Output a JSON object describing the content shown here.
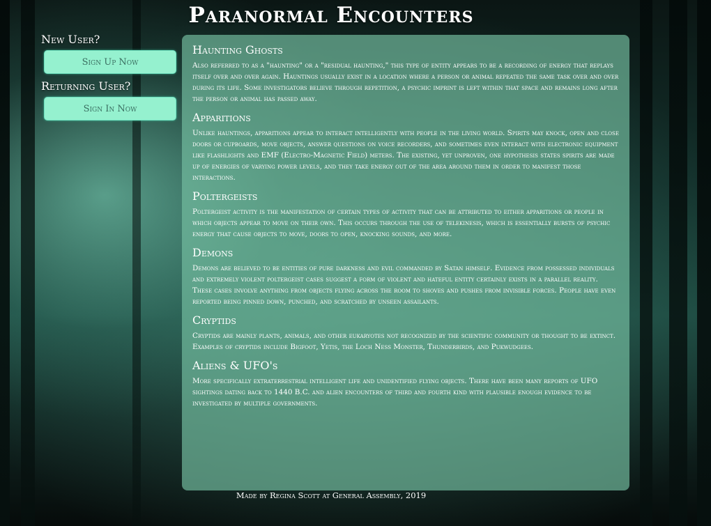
{
  "header": {
    "title": "Paranormal Encounters"
  },
  "sidebar": {
    "new_user_label": "New User?",
    "sign_up_label": "Sign Up Now",
    "returning_user_label": "Returning User?",
    "sign_in_label": "Sign In Now"
  },
  "main": {
    "sections": [
      {
        "heading": "Haunting Ghosts",
        "body": "Also referred to as a \"haunting\" or a \"residual haunting,\" this type of entity appears to be a recording of energy that replays itself over and over again. Hauntings usually exist in a location where a person or animal repeated the same task over and over during its life. Some investigators believe through repetition, a psychic imprint is left within that space and remains long after the person or animal has passed away."
      },
      {
        "heading": "Apparitions",
        "body": "Unlike hauntings, apparitions appear to interact intelligently with people in the living world. Spirits may knock, open and close doors or cupboards, move objects, answer questions on voice recorders, and sometimes even interact with electronic equipment like flashlights and EMF (Electro-Magnetic Field) meters. The existing, yet unproven, one hypothesis states spirits are made up of energies of varying power levels, and they take energy out of the area around them in order to manifest those interactions."
      },
      {
        "heading": "Poltergeists",
        "body": "Poltergeist activity is the manifestation of certain types of activity that can be attributed to either apparitions or people in which objects appear to move on their own. This occurs through the use of telekinesis, which is essentially bursts of psychic energy that cause objects to move, doors to open, knocking sounds, and more."
      },
      {
        "heading": "Demons",
        "body": "Demons are believed to be entities of pure darkness and evil commanded by Satan himself. Evidence from possessed individuals and extremely violent poltergeist cases suggest a form of violent and hateful entity certainly exists in a parallel reality. These cases involve anything from objects flying across the room to shoves and pushes from invisible forces. People have even reported being pinned down, punched, and scratched by unseen assailants."
      },
      {
        "heading": "Cryptids",
        "body": "Cryptids are mainly plants, animals, and other eukaryotes not recognized by the scientific community or thought to be extinct. Examples of cryptids include Bigfoot, Yetis, the Loch Ness Monster, Thunderbirds, and Pukwudgees."
      },
      {
        "heading": "Aliens & UFO's",
        "body": "More specifically extraterrestrial intelligent life and unidentified flying objects. There have been many reports of UFO sightings dating back to 1440 B.C. and alien encounters of third and fourth kind with plausible enough evidence to be investigated by multiple governments."
      }
    ]
  },
  "footer": {
    "credit": "Made by Regina Scott at General Assembly, 2019"
  }
}
